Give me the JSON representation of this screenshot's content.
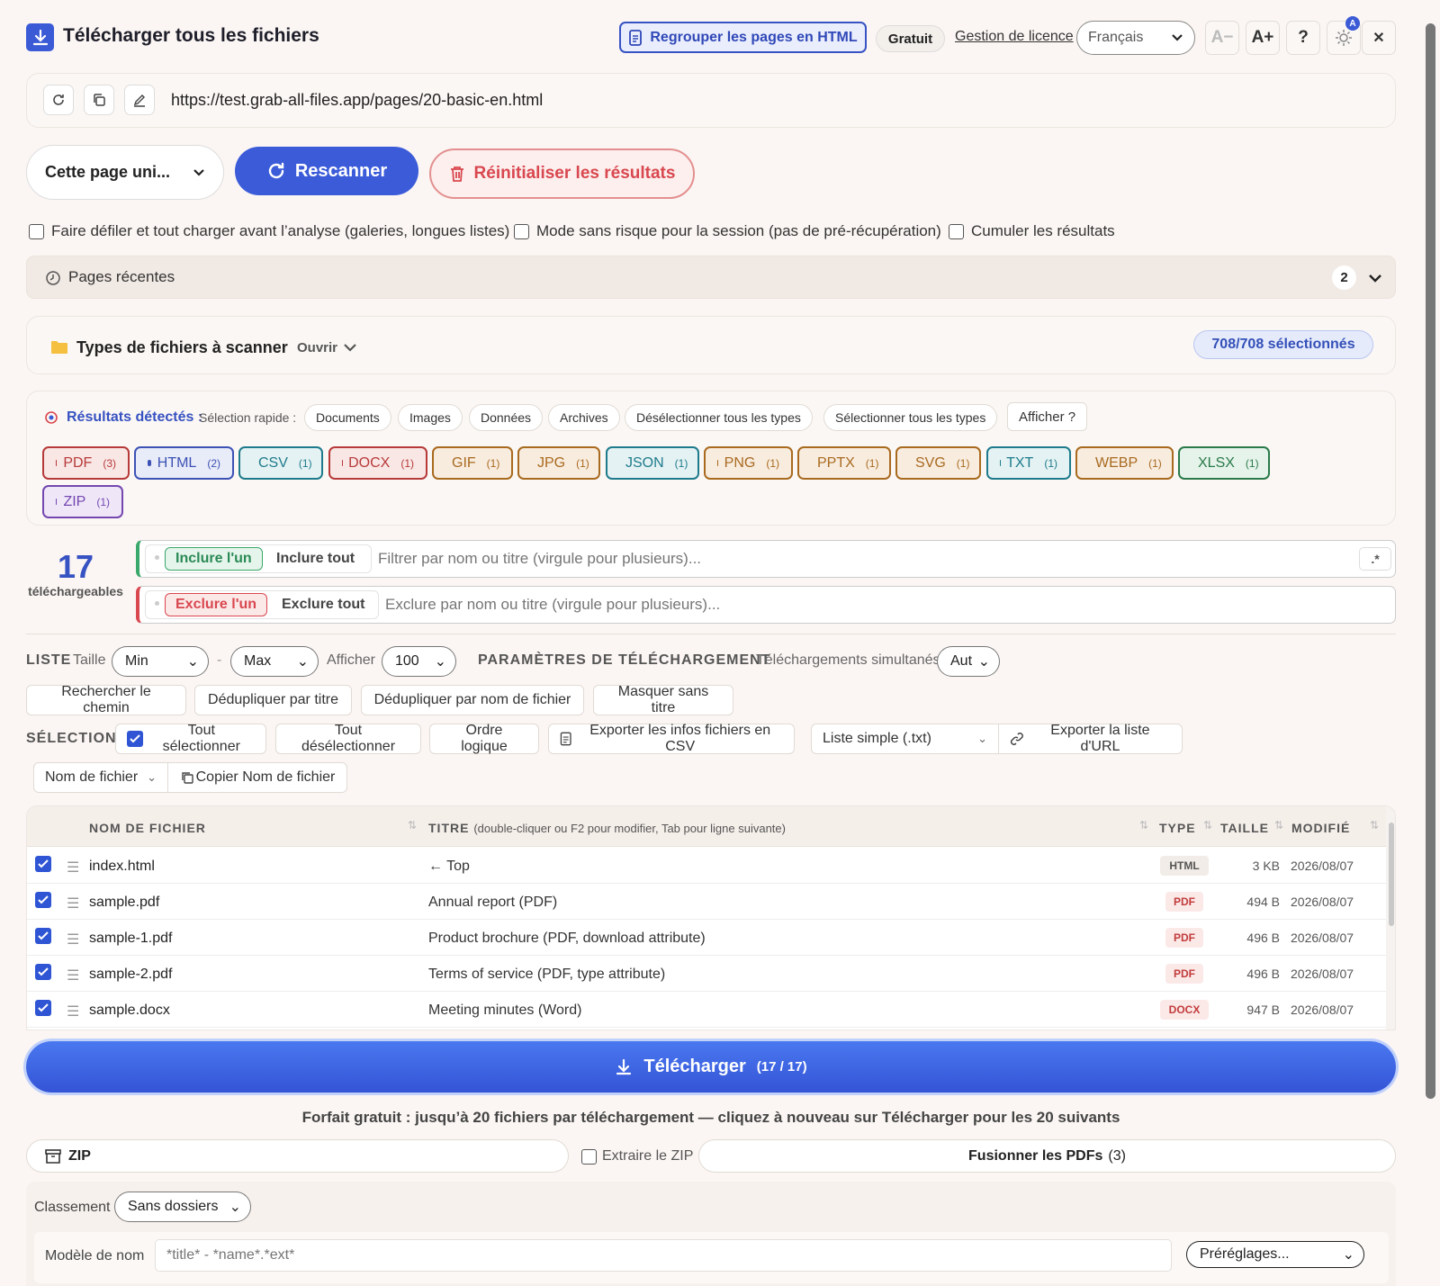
{
  "header": {
    "title": "Télécharger tous les fichiers",
    "merge_html": "Regrouper les pages en HTML",
    "plan_badge": "Gratuit",
    "license_link": "Gestion de licence",
    "language": "Français",
    "font_minus": "A−",
    "font_plus": "A+",
    "help": "?",
    "theme_badge": "A",
    "close": "✕"
  },
  "url": "https://test.grab-all-files.app/pages/20-basic-en.html",
  "scope": "Cette page uni...",
  "rescan": "Rescanner",
  "reset": "Réinitialiser les résultats",
  "options": [
    "Faire défiler et tout charger avant l’analyse (galeries, longues listes)",
    "Mode sans risque pour la session (pas de pré-récupération)",
    "Cumuler les résultats"
  ],
  "recent": {
    "label": "Pages récentes",
    "count": "2"
  },
  "filetypes": {
    "label": "Types de fichiers à scanner",
    "toggle": "Ouvrir",
    "selected": "708/708 sélectionnés"
  },
  "results": {
    "label": "Résultats détectés :",
    "quick": "Sélection rapide :",
    "quick_buttons": [
      "Documents",
      "Images",
      "Données",
      "Archives",
      "Désélectionner tous les types",
      "Sélectionner tous les types"
    ],
    "show": "Afficher ?",
    "chips": [
      {
        "label": "PDF",
        "count": "(3)",
        "color": "#b63a3a",
        "bg": "#f9e7e5"
      },
      {
        "label": "HTML",
        "count": "(2)",
        "color": "#3d52b5",
        "bg": "#e8ebf8"
      },
      {
        "label": "CSV",
        "count": "(1)",
        "color": "#1e7b8c",
        "bg": "#e5f2f3"
      },
      {
        "label": "DOCX",
        "count": "(1)",
        "color": "#b63a3a",
        "bg": "#f9e7e5"
      },
      {
        "label": "GIF",
        "count": "(1)",
        "color": "#a86a1f",
        "bg": "#f8ecdf"
      },
      {
        "label": "JPG",
        "count": "(1)",
        "color": "#a86a1f",
        "bg": "#f8ecdf"
      },
      {
        "label": "JSON",
        "count": "(1)",
        "color": "#1e7b8c",
        "bg": "#e5f2f3"
      },
      {
        "label": "PNG",
        "count": "(1)",
        "color": "#a86a1f",
        "bg": "#f8ecdf"
      },
      {
        "label": "PPTX",
        "count": "(1)",
        "color": "#a86a1f",
        "bg": "#f8ecdf"
      },
      {
        "label": "SVG",
        "count": "(1)",
        "color": "#a86a1f",
        "bg": "#f8ecdf"
      },
      {
        "label": "TXT",
        "count": "(1)",
        "color": "#1e7b8c",
        "bg": "#e5f2f3"
      },
      {
        "label": "WEBP",
        "count": "(1)",
        "color": "#a86a1f",
        "bg": "#f8ecdf"
      },
      {
        "label": "XLSX",
        "count": "(1)",
        "color": "#2a7a4a",
        "bg": "#e5f3ea"
      },
      {
        "label": "ZIP",
        "count": "(1)",
        "color": "#7447b0",
        "bg": "#efe7f8"
      }
    ]
  },
  "filter": {
    "count": "17",
    "count_label": "téléchargeables",
    "include_one": "Inclure l'un",
    "include_all": "Inclure tout",
    "include_placeholder": "Filtrer par nom ou titre (virgule pour plusieurs)...",
    "regex": ".*",
    "exclude_one": "Exclure l'un",
    "exclude_all": "Exclure tout",
    "exclude_placeholder": "Exclure par nom ou titre (virgule pour plusieurs)..."
  },
  "list": {
    "section": "LISTE",
    "size": "Taille",
    "min": "Min",
    "dash": "-",
    "max": "Max",
    "show": "Afficher",
    "per_page": "100",
    "dl_section": "PARAMÈTRES DE TÉLÉCHARGEMENT",
    "concurrent": "Téléchargements simultanés",
    "concurrent_value": "Aut",
    "tools": [
      "Rechercher le chemin",
      "Dédupliquer par titre",
      "Dédupliquer par nom de fichier",
      "Masquer sans titre"
    ]
  },
  "selection": {
    "section": "SÉLECTION",
    "select_all": "Tout sélectionner",
    "deselect_all": "Tout désélectionner",
    "logical_order": "Ordre logique",
    "export_csv": "Exporter les infos fichiers en CSV",
    "list_format": "Liste simple (.txt)",
    "export_urls": "Exporter la liste d'URL",
    "copy_field": "Nom de fichier",
    "copy_button": "Copier Nom de fichier"
  },
  "table": {
    "headers": {
      "name": "NOM DE FICHIER",
      "title": "TITRE",
      "title_hint": "(double-cliquer ou F2 pour modifier, Tab pour ligne suivante)",
      "type": "TYPE",
      "size": "TAILLE",
      "modified": "MODIFIÉ"
    },
    "rows": [
      {
        "name": "index.html",
        "title": "← Top",
        "type": "HTML",
        "size": "3 KB",
        "modified": "2026/08/07"
      },
      {
        "name": "sample.pdf",
        "title": "Annual report (PDF)",
        "type": "PDF",
        "size": "494 B",
        "modified": "2026/08/07"
      },
      {
        "name": "sample-1.pdf",
        "title": "Product brochure (PDF, download attribute)",
        "type": "PDF",
        "size": "496 B",
        "modified": "2026/08/07"
      },
      {
        "name": "sample-2.pdf",
        "title": "Terms of service (PDF, type attribute)",
        "type": "PDF",
        "size": "496 B",
        "modified": "2026/08/07"
      },
      {
        "name": "sample.docx",
        "title": "Meeting minutes (Word)",
        "type": "DOCX",
        "size": "947 B",
        "modified": "2026/08/07"
      }
    ]
  },
  "download": {
    "label": "Télécharger",
    "count": "(17 / 17)"
  },
  "plan_note": "Forfait gratuit : jusqu’à 20 fichiers par téléchargement — cliquez à nouveau sur Télécharger pour les 20 suivants",
  "zip": "ZIP",
  "extract_zip": "Extraire le ZIP",
  "merge_pdfs": "Fusionner les PDFs",
  "merge_count": "(3)",
  "classement": {
    "label": "Classement",
    "value": "Sans dossiers"
  },
  "name_model": {
    "label": "Modèle de nom",
    "placeholder": "*title* - *name*.*ext*",
    "presets": "Préréglages..."
  }
}
